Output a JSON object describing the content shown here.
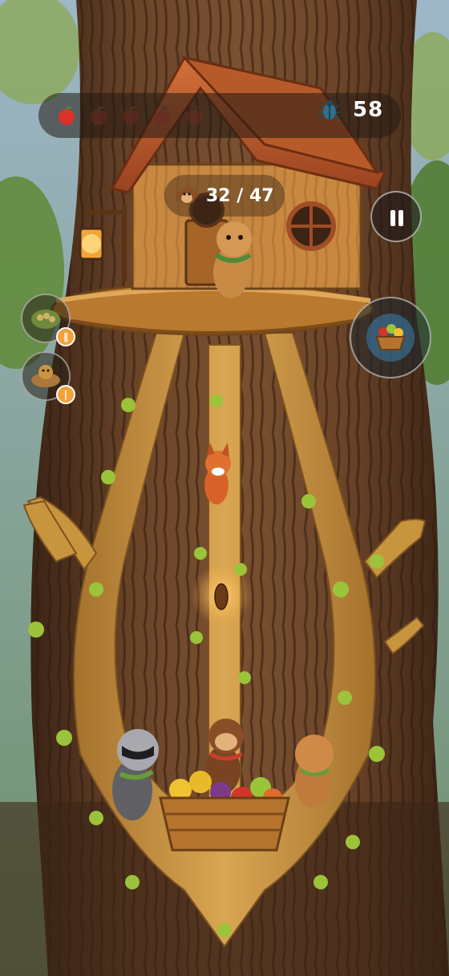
{
  "hud": {
    "lives": [
      {
        "state": "full"
      },
      {
        "state": "empty"
      },
      {
        "state": "empty"
      },
      {
        "state": "empty"
      },
      {
        "state": "empty"
      }
    ],
    "score": "58",
    "score_icon": "beetle-icon",
    "collected": "32 / 47",
    "collected_icon": "monkey-face-icon"
  },
  "controls": {
    "pause_icon": "pause-icon",
    "basket_icon": "fruit-basket-icon"
  },
  "powerups": [
    {
      "name": "seed-pile-powerup",
      "icon": "seeds-icon",
      "badge": "∥"
    },
    {
      "name": "bird-nest-powerup",
      "icon": "nest-icon",
      "badge": "|"
    }
  ],
  "characters": [
    "meerkat",
    "fox",
    "raccoon",
    "monkey",
    "squirrel"
  ],
  "colors": {
    "bark_dark": "#4a2e1c",
    "branch": "#c8953f",
    "roof": "#b5522a",
    "leaf": "#9bc43a",
    "badge": "#f2a23a"
  }
}
